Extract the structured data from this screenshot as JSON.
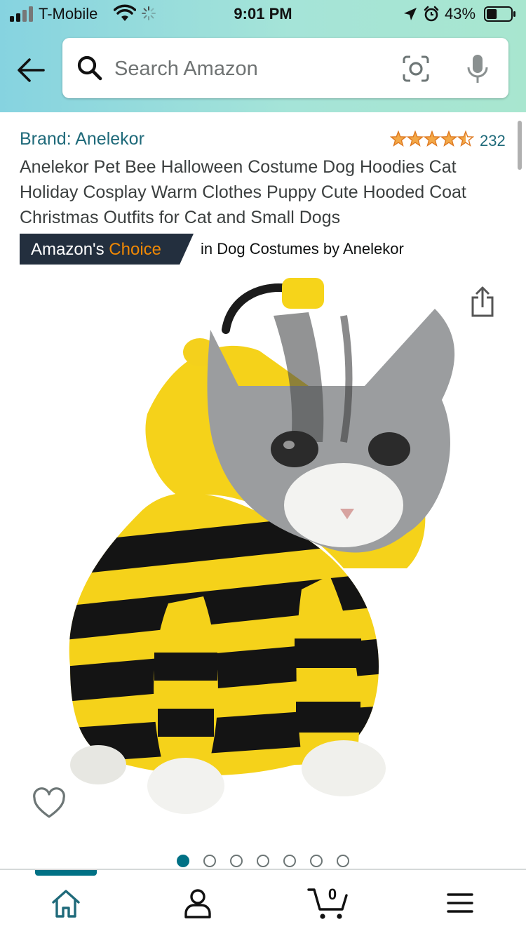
{
  "status_bar": {
    "carrier": "T-Mobile",
    "time": "9:01 PM",
    "battery_percent": "43%",
    "battery_level": 0.43,
    "icons": [
      "signal-icon",
      "wifi-icon",
      "activity-spinner-icon",
      "location-arrow-icon",
      "alarm-icon",
      "battery-icon"
    ]
  },
  "search": {
    "placeholder": "Search Amazon",
    "icons": [
      "back-arrow-icon",
      "search-icon",
      "camera-scan-icon",
      "microphone-icon"
    ]
  },
  "product": {
    "brand": "Brand: Anelekor",
    "rating": 4.5,
    "review_count": "232",
    "title": "Anelekor Pet Bee Halloween Costume Dog Hoodies Cat Holiday Cosplay Warm Clothes Puppy Cute Hooded Coat Christmas Outfits for Cat and Small Dogs",
    "badge_prefix": "Amazon's ",
    "badge_accent": "Choice",
    "badge_category": "in Dog Costumes by Anelekor",
    "image_count": 7,
    "image_index": 1
  },
  "bottom_nav": {
    "cart_count": "0",
    "items": [
      "home-icon",
      "account-icon",
      "cart-icon",
      "menu-icon"
    ],
    "active": "home"
  },
  "colors": {
    "header_gradient_start": "#86d3e0",
    "header_gradient_end": "#a8e6cf",
    "link": "#1f6a7a",
    "star": "#f3a847",
    "badge_bg": "#232f3e",
    "badge_accent": "#f08804",
    "active_nav": "#007185"
  }
}
